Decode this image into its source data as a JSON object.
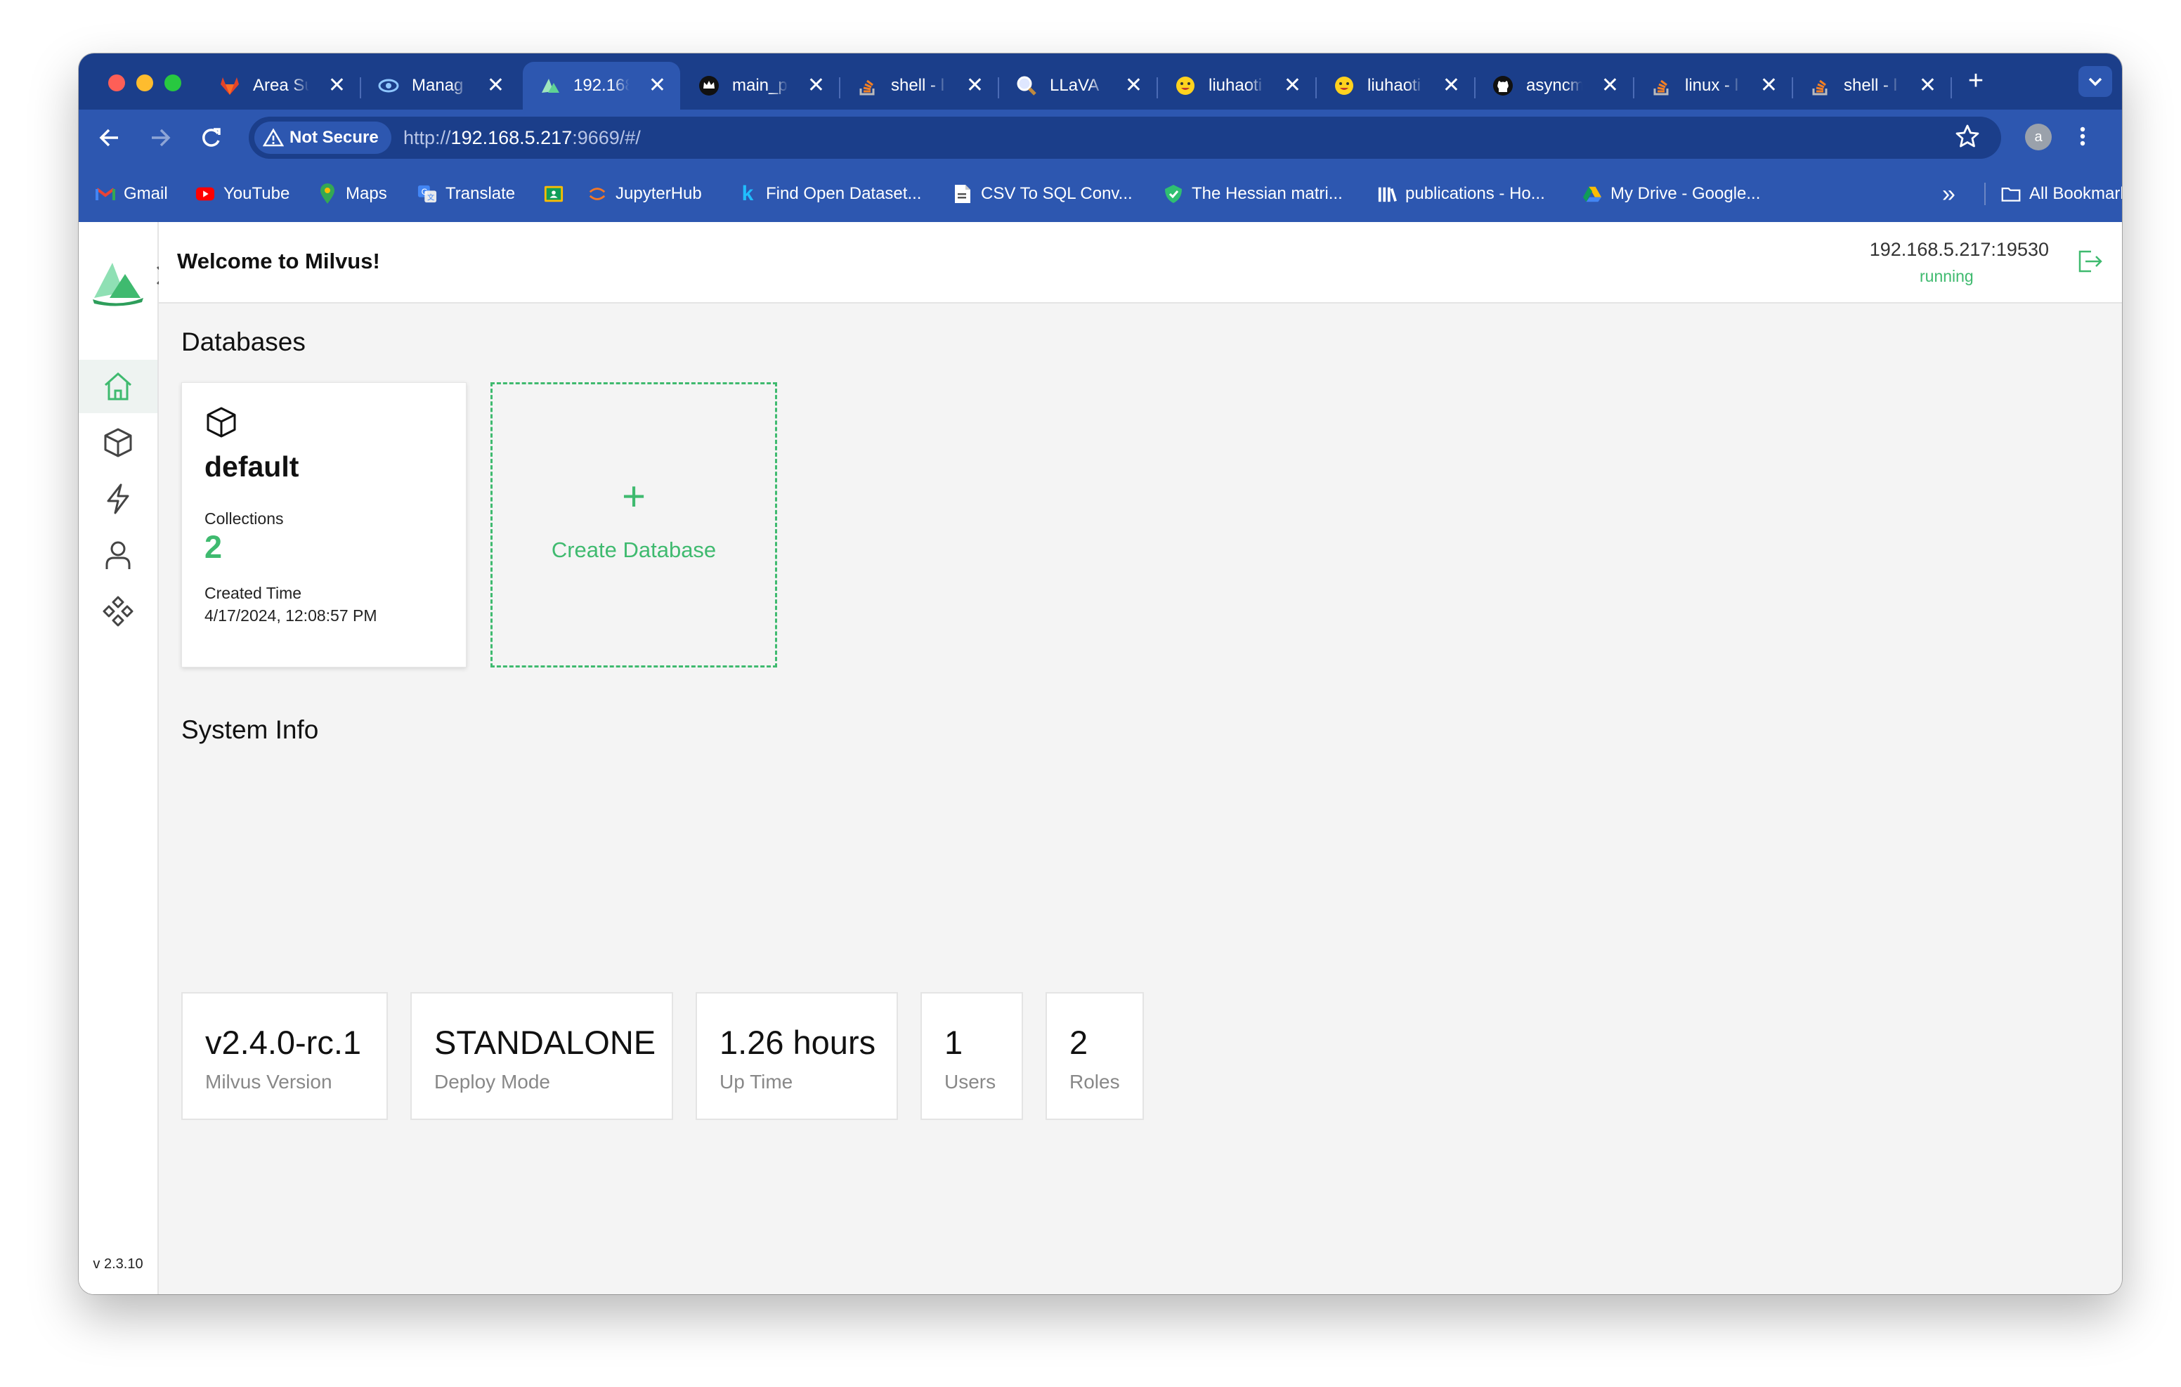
{
  "browser": {
    "tabs": [
      {
        "title": "Area Su",
        "icon": "gitlab-icon"
      },
      {
        "title": "Manag",
        "icon": "eye-icon"
      },
      {
        "title": "192.168",
        "icon": "milvus-icon",
        "active": true
      },
      {
        "title": "main_p",
        "icon": "crown-icon"
      },
      {
        "title": "shell - l",
        "icon": "stackoverflow-icon"
      },
      {
        "title": "LLaVA",
        "icon": "magnifier-icon"
      },
      {
        "title": "liuhaoti",
        "icon": "huggingface-icon"
      },
      {
        "title": "liuhaoti",
        "icon": "huggingface-icon"
      },
      {
        "title": "asyncm",
        "icon": "github-icon"
      },
      {
        "title": "linux - l",
        "icon": "stackoverflow-icon"
      },
      {
        "title": "shell - l",
        "icon": "stackoverflow-icon"
      }
    ],
    "tab_close": "✕",
    "new_tab": "+",
    "security_label": "Not Secure",
    "url_prefix": "http://",
    "url_host": "192.168.5.217",
    "url_rest": ":9669/#/",
    "profile_initial": "a",
    "bookmarks": [
      {
        "label": "Gmail",
        "icon": "gmail-icon"
      },
      {
        "label": "YouTube",
        "icon": "youtube-icon"
      },
      {
        "label": "Maps",
        "icon": "maps-icon"
      },
      {
        "label": "Translate",
        "icon": "translate-icon"
      },
      {
        "label": "",
        "icon": "classroom-icon"
      },
      {
        "label": "JupyterHub",
        "icon": "jupyter-icon"
      },
      {
        "label": "Find Open Dataset...",
        "icon": "kaggle-icon"
      },
      {
        "label": "CSV To SQL Conv...",
        "icon": "document-icon"
      },
      {
        "label": "The Hessian matri...",
        "icon": "shield-icon"
      },
      {
        "label": "publications - Ho...",
        "icon": "library-icon"
      },
      {
        "label": "My Drive - Google...",
        "icon": "drive-icon"
      }
    ],
    "more_bookmarks": "»",
    "all_bookmarks": "All Bookmarks"
  },
  "app": {
    "welcome": "Welcome to Milvus!",
    "server_address": "192.168.5.217:19530",
    "server_status": "running",
    "version": "v 2.3.10",
    "nav_items": [
      "home-icon",
      "collections-icon",
      "search-icon",
      "user-icon",
      "system-icon"
    ],
    "accent_color": "#3fba6f"
  },
  "databases": {
    "title": "Databases",
    "items": [
      {
        "name": "default",
        "collections_label": "Collections",
        "collections_count": "2",
        "created_label": "Created Time",
        "created_value": "4/17/2024, 12:08:57 PM"
      }
    ],
    "create_label": "Create Database",
    "create_plus": "+"
  },
  "system_info": {
    "title": "System Info",
    "items": [
      {
        "value": "v2.4.0-rc.1",
        "label": "Milvus Version"
      },
      {
        "value": "STANDALONE",
        "label": "Deploy Mode"
      },
      {
        "value": "1.26 hours",
        "label": "Up Time"
      },
      {
        "value": "1",
        "label": "Users"
      },
      {
        "value": "2",
        "label": "Roles"
      }
    ]
  }
}
